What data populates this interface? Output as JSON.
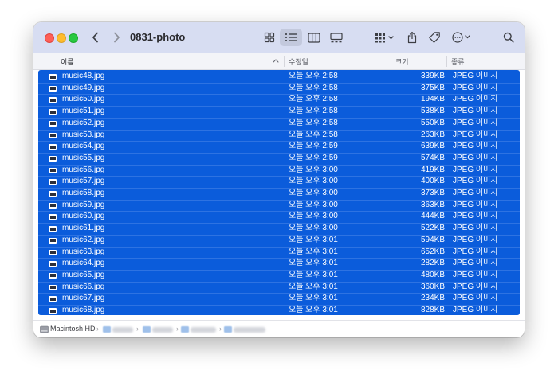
{
  "window": {
    "title": "0831-photo"
  },
  "toolbar": {
    "back_icon": "chevron-left-icon",
    "forward_icon": "chevron-right-icon",
    "view_buttons": [
      "icon-view-icon",
      "list-view-icon",
      "column-view-icon",
      "gallery-view-icon"
    ],
    "active_view": "list-view-icon",
    "group_icon": "group-by-icon",
    "share_icon": "share-icon",
    "tag_icon": "tag-icon",
    "more_icon": "ellipsis-circle-icon",
    "search_icon": "search-icon"
  },
  "columns": {
    "name": "이름",
    "date": "수정일",
    "size": "크기",
    "kind": "종류"
  },
  "files": [
    {
      "name": "music48.jpg",
      "date": "오늘 오후 2:58",
      "size": "339KB",
      "kind": "JPEG 이미지"
    },
    {
      "name": "music49.jpg",
      "date": "오늘 오후 2:58",
      "size": "375KB",
      "kind": "JPEG 이미지"
    },
    {
      "name": "music50.jpg",
      "date": "오늘 오후 2:58",
      "size": "194KB",
      "kind": "JPEG 이미지"
    },
    {
      "name": "music51.jpg",
      "date": "오늘 오후 2:58",
      "size": "538KB",
      "kind": "JPEG 이미지"
    },
    {
      "name": "music52.jpg",
      "date": "오늘 오후 2:58",
      "size": "550KB",
      "kind": "JPEG 이미지"
    },
    {
      "name": "music53.jpg",
      "date": "오늘 오후 2:58",
      "size": "263KB",
      "kind": "JPEG 이미지"
    },
    {
      "name": "music54.jpg",
      "date": "오늘 오후 2:59",
      "size": "639KB",
      "kind": "JPEG 이미지"
    },
    {
      "name": "music55.jpg",
      "date": "오늘 오후 2:59",
      "size": "574KB",
      "kind": "JPEG 이미지"
    },
    {
      "name": "music56.jpg",
      "date": "오늘 오후 3:00",
      "size": "419KB",
      "kind": "JPEG 이미지"
    },
    {
      "name": "music57.jpg",
      "date": "오늘 오후 3:00",
      "size": "400KB",
      "kind": "JPEG 이미지"
    },
    {
      "name": "music58.jpg",
      "date": "오늘 오후 3:00",
      "size": "373KB",
      "kind": "JPEG 이미지"
    },
    {
      "name": "music59.jpg",
      "date": "오늘 오후 3:00",
      "size": "363KB",
      "kind": "JPEG 이미지"
    },
    {
      "name": "music60.jpg",
      "date": "오늘 오후 3:00",
      "size": "444KB",
      "kind": "JPEG 이미지"
    },
    {
      "name": "music61.jpg",
      "date": "오늘 오후 3:00",
      "size": "522KB",
      "kind": "JPEG 이미지"
    },
    {
      "name": "music62.jpg",
      "date": "오늘 오후 3:01",
      "size": "594KB",
      "kind": "JPEG 이미지"
    },
    {
      "name": "music63.jpg",
      "date": "오늘 오후 3:01",
      "size": "652KB",
      "kind": "JPEG 이미지"
    },
    {
      "name": "music64.jpg",
      "date": "오늘 오후 3:01",
      "size": "282KB",
      "kind": "JPEG 이미지"
    },
    {
      "name": "music65.jpg",
      "date": "오늘 오후 3:01",
      "size": "480KB",
      "kind": "JPEG 이미지"
    },
    {
      "name": "music66.jpg",
      "date": "오늘 오후 3:01",
      "size": "360KB",
      "kind": "JPEG 이미지"
    },
    {
      "name": "music67.jpg",
      "date": "오늘 오후 3:01",
      "size": "234KB",
      "kind": "JPEG 이미지"
    },
    {
      "name": "music68.jpg",
      "date": "오늘 오후 3:01",
      "size": "828KB",
      "kind": "JPEG 이미지"
    }
  ],
  "statusbar": {
    "disk_label": "Macintosh HD",
    "disk_icon": "hard-drive-icon"
  },
  "colors": {
    "selection": "#0b5cdb",
    "toolbar": "#d7ddf2",
    "selection_text": "#ffffff"
  }
}
